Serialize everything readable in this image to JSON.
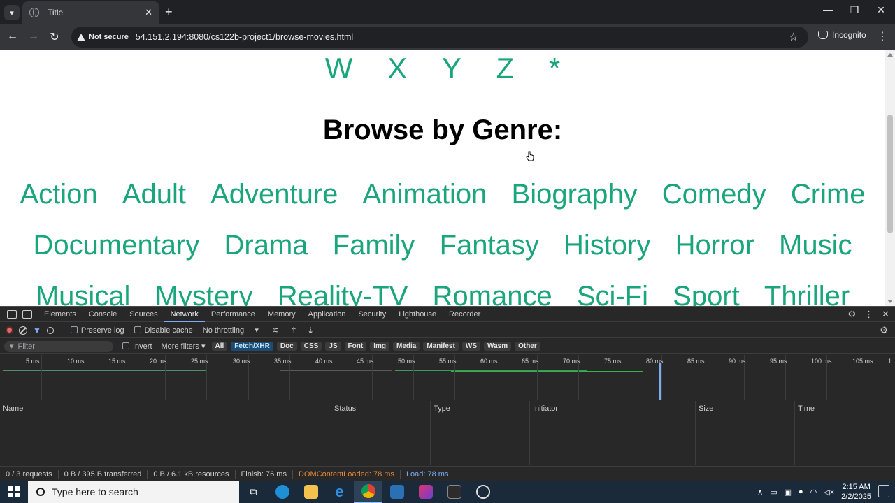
{
  "browser": {
    "tab_title": "Title",
    "security_label": "Not secure",
    "url": "54.151.2.194:8080/cs122b-project1/browse-movies.html",
    "incognito_label": "Incognito"
  },
  "page": {
    "alpha_letters": [
      "W",
      "X",
      "Y",
      "Z",
      "*"
    ],
    "genre_heading": "Browse by Genre:",
    "genre_rows": [
      [
        "Action",
        "Adult",
        "Adventure",
        "Animation",
        "Biography",
        "Comedy",
        "Crime"
      ],
      [
        "Documentary",
        "Drama",
        "Family",
        "Fantasy",
        "History",
        "Horror",
        "Music"
      ],
      [
        "Musical",
        "Mystery",
        "Reality-TV",
        "Romance",
        "Sci-Fi",
        "Sport",
        "Thriller"
      ]
    ],
    "link_color": "#1aa57d"
  },
  "devtools": {
    "tabs": [
      "Elements",
      "Console",
      "Sources",
      "Network",
      "Performance",
      "Memory",
      "Application",
      "Security",
      "Lighthouse",
      "Recorder"
    ],
    "active_tab": "Network",
    "preserve_log": "Preserve log",
    "disable_cache": "Disable cache",
    "throttling": "No throttling",
    "filter_placeholder": "Filter",
    "invert": "Invert",
    "more_filters": "More filters",
    "type_filters": [
      "All",
      "Fetch/XHR",
      "Doc",
      "CSS",
      "JS",
      "Font",
      "Img",
      "Media",
      "Manifest",
      "WS",
      "Wasm",
      "Other"
    ],
    "active_filter": "Fetch/XHR",
    "timeline_ticks": [
      "5 ms",
      "10 ms",
      "15 ms",
      "20 ms",
      "25 ms",
      "30 ms",
      "35 ms",
      "40 ms",
      "45 ms",
      "50 ms",
      "55 ms",
      "60 ms",
      "65 ms",
      "70 ms",
      "75 ms",
      "80 ms",
      "85 ms",
      "90 ms",
      "95 ms",
      "100 ms",
      "105 ms",
      "1"
    ],
    "columns": [
      "Name",
      "Status",
      "Type",
      "Initiator",
      "Size",
      "Time"
    ],
    "status": {
      "requests": "0 / 3 requests",
      "transferred": "0 B / 395 B transferred",
      "resources": "0 B / 6.1 kB resources",
      "finish": "Finish: 76 ms",
      "dom_content_loaded": "DOMContentLoaded: 78 ms",
      "load": "Load: 78 ms"
    }
  },
  "taskbar": {
    "search_placeholder": "Type here to search",
    "time": "2:15 AM",
    "date": "2/2/2025"
  }
}
